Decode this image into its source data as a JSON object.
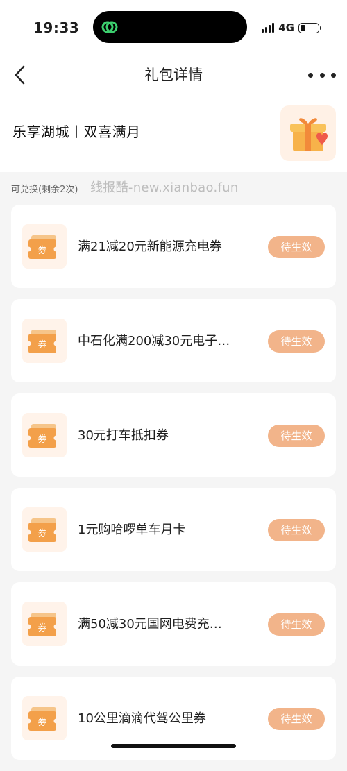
{
  "status_bar": {
    "time": "19:33",
    "network": "4G",
    "battery_level": 0.3
  },
  "nav": {
    "title": "礼包详情"
  },
  "package": {
    "title": "乐享湖城丨双喜满月"
  },
  "remain_text": "可兑换(剩余2次)",
  "watermark": "线报酷-new.xianbao.fun",
  "coupons": [
    {
      "icon_text": "券",
      "label": "满21减20元新能源充电券",
      "status": "待生效"
    },
    {
      "icon_text": "券",
      "label": "中石化满200减30元电子…",
      "status": "待生效"
    },
    {
      "icon_text": "券",
      "label": "30元打车抵扣券",
      "status": "待生效"
    },
    {
      "icon_text": "券",
      "label": "1元购哈啰单车月卡",
      "status": "待生效"
    },
    {
      "icon_text": "券",
      "label": "满50减30元国网电费充…",
      "status": "待生效"
    },
    {
      "icon_text": "券",
      "label": "10公里滴滴代驾公里券",
      "status": "待生效"
    }
  ],
  "colors": {
    "accent_button": "#f2b48a",
    "coupon_orange": "#f3a04a",
    "background": "#f5f5f5"
  }
}
